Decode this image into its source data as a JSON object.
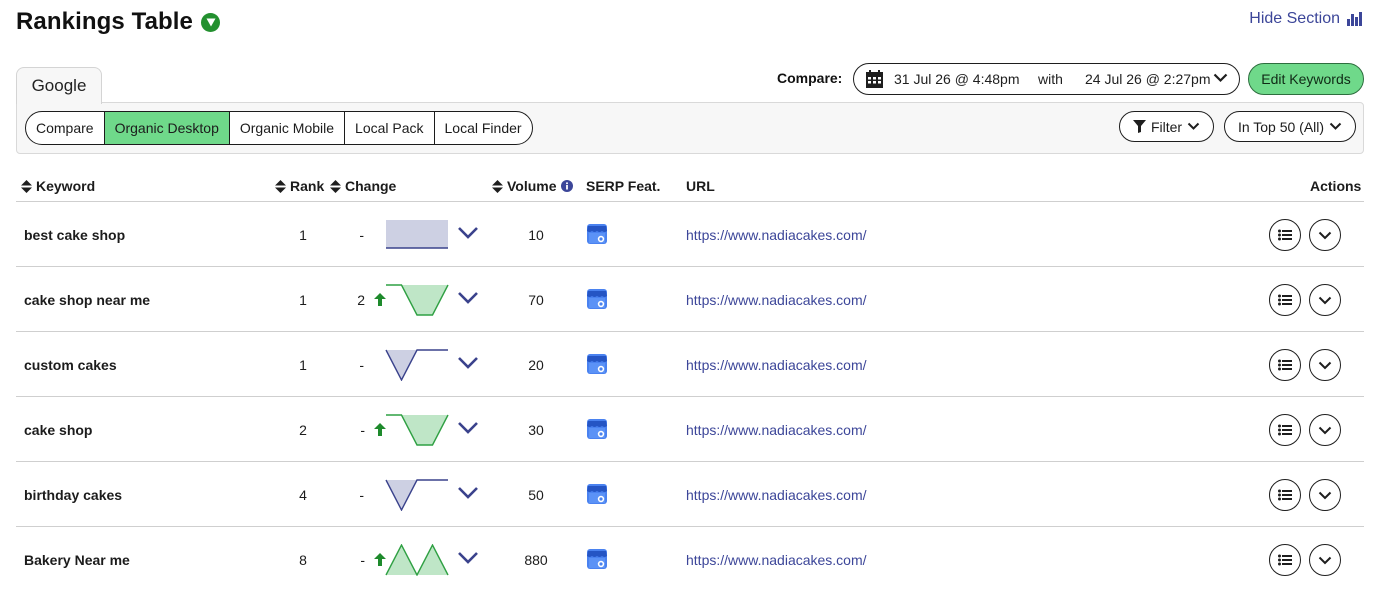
{
  "header": {
    "title": "Rankings Table",
    "hide_section": "Hide Section"
  },
  "engine_tab": "Google",
  "compare": {
    "label": "Compare:",
    "date_from": "31 Jul 26 @ 4:48pm",
    "with": "with",
    "date_to": "24 Jul 26 @ 2:27pm",
    "edit_keywords": "Edit Keywords"
  },
  "modes": [
    {
      "label": "Compare",
      "active": false
    },
    {
      "label": "Organic Desktop",
      "active": true
    },
    {
      "label": "Organic Mobile",
      "active": false
    },
    {
      "label": "Local Pack",
      "active": false
    },
    {
      "label": "Local Finder",
      "active": false
    }
  ],
  "filter_label": "Filter",
  "top_filter_label": "In Top 50 (All)",
  "columns": {
    "keyword": "Keyword",
    "rank": "Rank",
    "change": "Change",
    "volume": "Volume",
    "serp": "SERP Feat.",
    "url": "URL",
    "actions": "Actions"
  },
  "colors": {
    "accent_green": "#6fd98a",
    "link_blue": "#3c4699",
    "spark_neutral_fill": "#cdd0e3",
    "spark_neutral_line": "#3a428c",
    "spark_up_fill": "#bfe6c7",
    "spark_up_line": "#2fa043",
    "up_arrow": "#1e8a2c"
  },
  "rows": [
    {
      "keyword": "best cake shop",
      "rank": "1",
      "change": "-",
      "change_up": false,
      "spark": {
        "type": "neutral",
        "values": [
          1,
          1,
          1,
          1,
          1
        ]
      },
      "volume": "10",
      "serp_icon": "local-business-icon",
      "url": "https://www.nadiacakes.com/"
    },
    {
      "keyword": "cake shop near me",
      "rank": "1",
      "change": "2",
      "change_up": true,
      "spark": {
        "type": "up",
        "values": [
          1,
          1,
          3,
          3,
          1
        ]
      },
      "volume": "70",
      "serp_icon": "local-business-icon",
      "url": "https://www.nadiacakes.com/"
    },
    {
      "keyword": "custom cakes",
      "rank": "1",
      "change": "-",
      "change_up": false,
      "spark": {
        "type": "neutral",
        "values": [
          1,
          3,
          1,
          1,
          1
        ]
      },
      "volume": "20",
      "serp_icon": "local-business-icon",
      "url": "https://www.nadiacakes.com/"
    },
    {
      "keyword": "cake shop",
      "rank": "2",
      "change": "-",
      "change_up": true,
      "spark": {
        "type": "up",
        "values": [
          1,
          1,
          3,
          3,
          1
        ]
      },
      "volume": "30",
      "serp_icon": "local-business-icon",
      "url": "https://www.nadiacakes.com/"
    },
    {
      "keyword": "birthday cakes",
      "rank": "4",
      "change": "-",
      "change_up": false,
      "spark": {
        "type": "neutral",
        "values": [
          4,
          5,
          4,
          4,
          4
        ]
      },
      "volume": "50",
      "serp_icon": "local-business-icon",
      "url": "https://www.nadiacakes.com/"
    },
    {
      "keyword": "Bakery Near me",
      "rank": "8",
      "change": "-",
      "change_up": true,
      "spark": {
        "type": "up",
        "values": [
          8,
          7,
          8,
          7,
          8
        ]
      },
      "volume": "880",
      "serp_icon": "local-business-icon",
      "url": "https://www.nadiacakes.com/"
    }
  ]
}
